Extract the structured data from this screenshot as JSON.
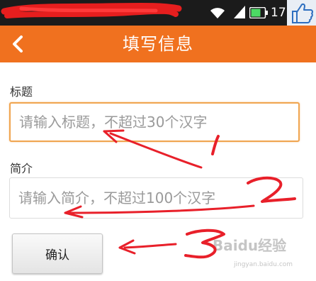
{
  "status_bar": {
    "clock": "17"
  },
  "header": {
    "title": "填写信息"
  },
  "form": {
    "title_label": "标题",
    "title_placeholder": "请输入标题，不超过30个汉字",
    "intro_label": "简介",
    "intro_placeholder": "请输入简介，不超过100个汉字",
    "confirm_label": "确认"
  },
  "annotations": {
    "numbers": [
      "1",
      "2",
      "3"
    ],
    "color": "#e8202a"
  },
  "watermark": {
    "brand": "Baidu经验",
    "url": "jingyan.baidu.com"
  },
  "colors": {
    "header": "#f0711f",
    "status_bar": "#1b1b1b",
    "focus_border": "#f0a550"
  }
}
